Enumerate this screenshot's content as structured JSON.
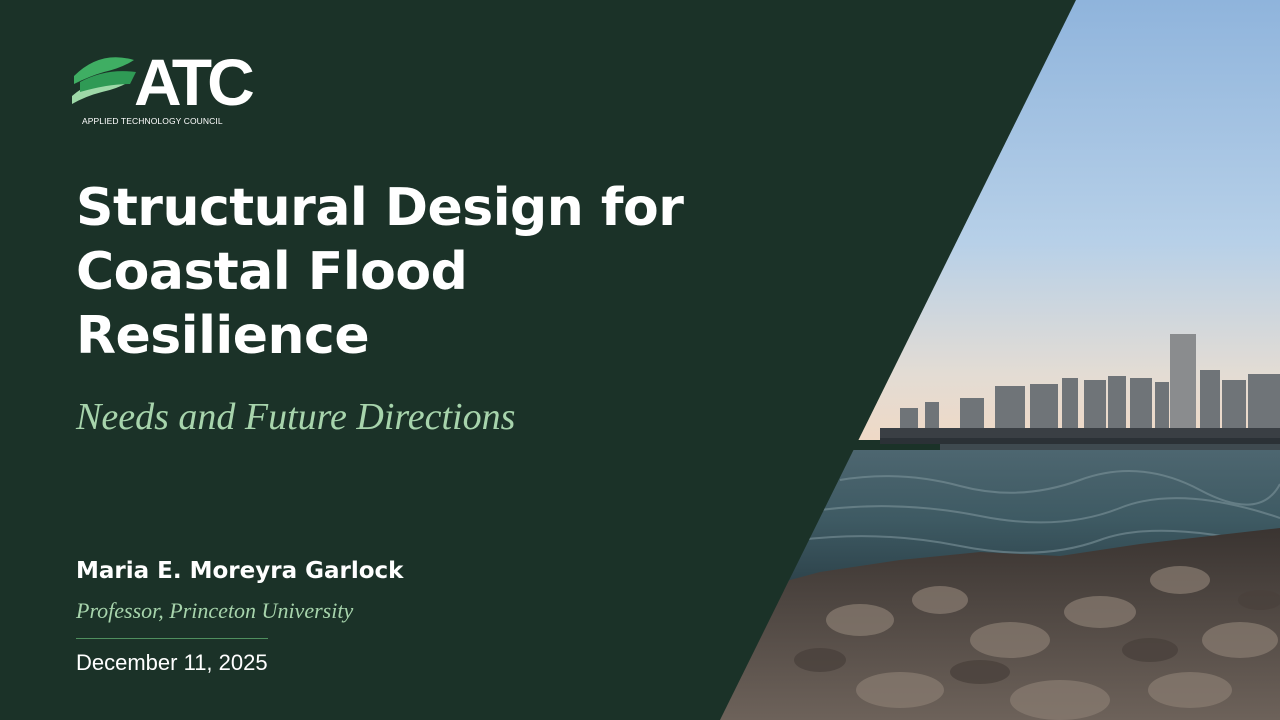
{
  "logo": {
    "text": "ATC",
    "subtitle": "APPLIED TECHNOLOGY COUNCIL"
  },
  "title": {
    "line1": "Structural Design for",
    "line2": "Coastal Flood",
    "line3": "Resilience"
  },
  "subtitle": "Needs and Future Directions",
  "presenter": {
    "name": "Maria E. Moreyra Garlock",
    "affiliation": "Professor, Princeton University"
  },
  "date": "December 11, 2025",
  "colors": {
    "background": "#1b3228",
    "accent_green": "#a7d4ac",
    "logo_green": "#2fa35a",
    "text": "#ffffff"
  }
}
